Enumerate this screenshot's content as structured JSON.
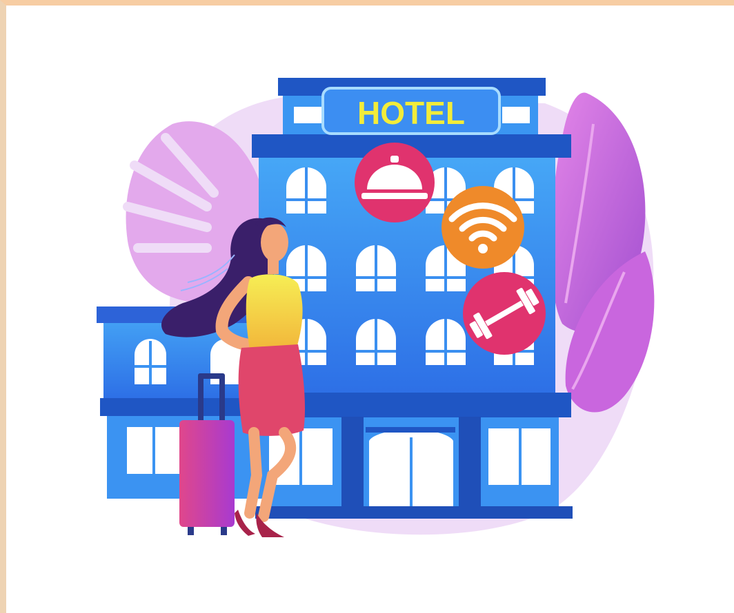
{
  "illustration": {
    "sign_text": "HOTEL",
    "amenity_icons": [
      "dining-cloche-icon",
      "wifi-icon",
      "dumbbell-icon"
    ],
    "colors": {
      "frame_top": "#f7cda3",
      "frame_left": "#eed3b3",
      "building_blue": "#3a8ff0",
      "building_dark": "#1f56c4",
      "sign_yellow": "#f2ec3a",
      "leaf_purple": "#c66ad8",
      "blob_lilac": "#efdcf7",
      "icon_pink": "#e0336e",
      "icon_orange": "#ef8a2a",
      "shirt_yellow": "#f2e44b",
      "skirt_red": "#e0466b",
      "suitcase_magenta": "#c43db7"
    }
  }
}
